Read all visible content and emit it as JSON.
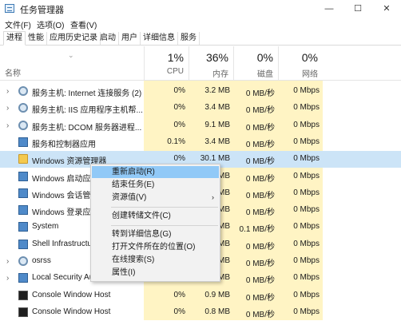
{
  "window": {
    "title": "任务管理器",
    "minimize": "—",
    "maximize": "☐",
    "close": "✕"
  },
  "menu": [
    "文件(F)",
    "选项(O)",
    "查看(V)"
  ],
  "tabs": [
    "进程",
    "性能",
    "应用历史记录",
    "启动",
    "用户",
    "详细信息",
    "服务"
  ],
  "active_tab": "进程",
  "columns": {
    "name": "名称",
    "cpu": {
      "pct": "1%",
      "label": "CPU"
    },
    "memory": {
      "pct": "36%",
      "label": "内存"
    },
    "disk": {
      "pct": "0%",
      "label": "磁盘"
    },
    "network": {
      "pct": "0%",
      "label": "网络"
    }
  },
  "rows": [
    {
      "name": "服务主机: Internet 连接服务 (2)",
      "cpu": "0%",
      "memory": "3.2 MB",
      "disk": "0 MB/秒",
      "network": "0 Mbps",
      "icon": "gear-icon",
      "expandable": true
    },
    {
      "name": "服务主机: IIS 应用程序主机帮...",
      "cpu": "0%",
      "memory": "3.4 MB",
      "disk": "0 MB/秒",
      "network": "0 Mbps",
      "icon": "gear-icon",
      "expandable": true
    },
    {
      "name": "服务主机: DCOM 服务器进程...",
      "cpu": "0%",
      "memory": "9.1 MB",
      "disk": "0 MB/秒",
      "network": "0 Mbps",
      "icon": "gear-icon",
      "expandable": true
    },
    {
      "name": "服务和控制器应用",
      "cpu": "0.1%",
      "memory": "3.4 MB",
      "disk": "0 MB/秒",
      "network": "0 Mbps",
      "icon": "app-icon",
      "expandable": false
    },
    {
      "name": "Windows 资源管理器",
      "cpu": "0%",
      "memory": "30.1 MB",
      "disk": "0 MB/秒",
      "network": "0 Mbps",
      "icon": "folder-icon",
      "expandable": false
    },
    {
      "name": "Windows 启动应用",
      "cpu": "",
      "memory": "MB",
      "disk": "0 MB/秒",
      "network": "0 Mbps",
      "icon": "app-icon",
      "expandable": false
    },
    {
      "name": "Windows 会话管理",
      "cpu": "",
      "memory": "MB",
      "disk": "0 MB/秒",
      "network": "0 Mbps",
      "icon": "app-icon",
      "expandable": false
    },
    {
      "name": "Windows 登录应用",
      "cpu": "",
      "memory": "MB",
      "disk": "0 MB/秒",
      "network": "0 Mbps",
      "icon": "app-icon",
      "expandable": false
    },
    {
      "name": "System",
      "cpu": "",
      "memory": "MB",
      "disk": "0.1 MB/秒",
      "network": "0 Mbps",
      "icon": "app-icon",
      "expandable": false
    },
    {
      "name": "Shell Infrastructu",
      "cpu": "",
      "memory": "MB",
      "disk": "0 MB/秒",
      "network": "0 Mbps",
      "icon": "app-icon",
      "expandable": false
    },
    {
      "name": "osrss",
      "cpu": "",
      "memory": "MB",
      "disk": "0 MB/秒",
      "network": "0 Mbps",
      "icon": "gear-icon",
      "expandable": true
    },
    {
      "name": "Local Security Au",
      "cpu": "",
      "memory": "MB",
      "disk": "0 MB/秒",
      "network": "0 Mbps",
      "icon": "app-icon",
      "expandable": true
    },
    {
      "name": "Console Window Host",
      "cpu": "0%",
      "memory": "0.9 MB",
      "disk": "0 MB/秒",
      "network": "0 Mbps",
      "icon": "console-icon",
      "expandable": false
    },
    {
      "name": "Console Window Host",
      "cpu": "0%",
      "memory": "0.8 MB",
      "disk": "0 MB/秒",
      "network": "0 Mbps",
      "icon": "console-icon",
      "expandable": false
    }
  ],
  "context_menu": [
    {
      "label": "重新启动(R)",
      "highlighted": true
    },
    {
      "label": "结束任务(E)"
    },
    {
      "label": "资源值(V)",
      "submenu": true
    },
    {
      "label": "创建转储文件(C)"
    },
    {
      "label": "转到详细信息(G)"
    },
    {
      "label": "打开文件所在的位置(O)"
    },
    {
      "label": "在线搜索(S)"
    },
    {
      "label": "属性(I)"
    }
  ],
  "colors": {
    "usage_highlight": "#fff4c4",
    "selected_row": "#cce4f7",
    "menu_highlight": "#91c9f7"
  }
}
